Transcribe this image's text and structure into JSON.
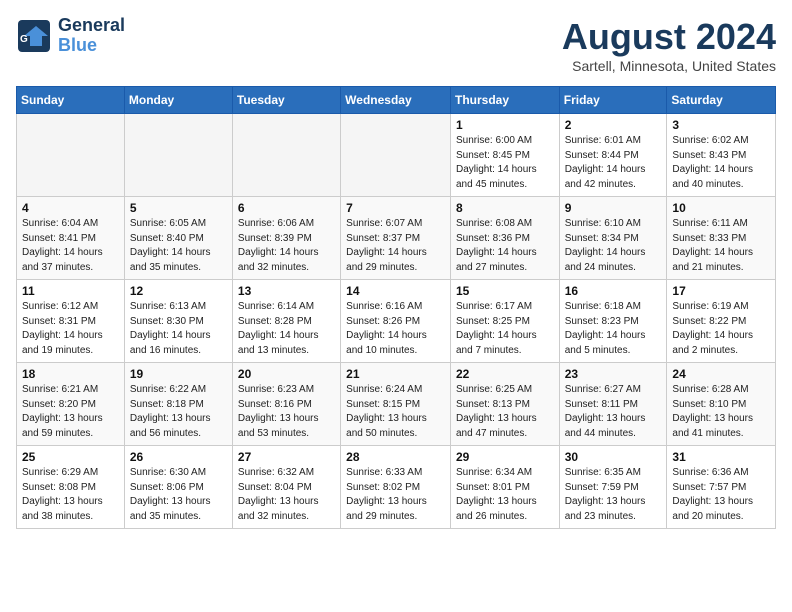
{
  "header": {
    "logo_line1": "General",
    "logo_line2": "Blue",
    "month": "August 2024",
    "location": "Sartell, Minnesota, United States"
  },
  "weekdays": [
    "Sunday",
    "Monday",
    "Tuesday",
    "Wednesday",
    "Thursday",
    "Friday",
    "Saturday"
  ],
  "weeks": [
    [
      {
        "day": "",
        "info": ""
      },
      {
        "day": "",
        "info": ""
      },
      {
        "day": "",
        "info": ""
      },
      {
        "day": "",
        "info": ""
      },
      {
        "day": "1",
        "info": "Sunrise: 6:00 AM\nSunset: 8:45 PM\nDaylight: 14 hours\nand 45 minutes."
      },
      {
        "day": "2",
        "info": "Sunrise: 6:01 AM\nSunset: 8:44 PM\nDaylight: 14 hours\nand 42 minutes."
      },
      {
        "day": "3",
        "info": "Sunrise: 6:02 AM\nSunset: 8:43 PM\nDaylight: 14 hours\nand 40 minutes."
      }
    ],
    [
      {
        "day": "4",
        "info": "Sunrise: 6:04 AM\nSunset: 8:41 PM\nDaylight: 14 hours\nand 37 minutes."
      },
      {
        "day": "5",
        "info": "Sunrise: 6:05 AM\nSunset: 8:40 PM\nDaylight: 14 hours\nand 35 minutes."
      },
      {
        "day": "6",
        "info": "Sunrise: 6:06 AM\nSunset: 8:39 PM\nDaylight: 14 hours\nand 32 minutes."
      },
      {
        "day": "7",
        "info": "Sunrise: 6:07 AM\nSunset: 8:37 PM\nDaylight: 14 hours\nand 29 minutes."
      },
      {
        "day": "8",
        "info": "Sunrise: 6:08 AM\nSunset: 8:36 PM\nDaylight: 14 hours\nand 27 minutes."
      },
      {
        "day": "9",
        "info": "Sunrise: 6:10 AM\nSunset: 8:34 PM\nDaylight: 14 hours\nand 24 minutes."
      },
      {
        "day": "10",
        "info": "Sunrise: 6:11 AM\nSunset: 8:33 PM\nDaylight: 14 hours\nand 21 minutes."
      }
    ],
    [
      {
        "day": "11",
        "info": "Sunrise: 6:12 AM\nSunset: 8:31 PM\nDaylight: 14 hours\nand 19 minutes."
      },
      {
        "day": "12",
        "info": "Sunrise: 6:13 AM\nSunset: 8:30 PM\nDaylight: 14 hours\nand 16 minutes."
      },
      {
        "day": "13",
        "info": "Sunrise: 6:14 AM\nSunset: 8:28 PM\nDaylight: 14 hours\nand 13 minutes."
      },
      {
        "day": "14",
        "info": "Sunrise: 6:16 AM\nSunset: 8:26 PM\nDaylight: 14 hours\nand 10 minutes."
      },
      {
        "day": "15",
        "info": "Sunrise: 6:17 AM\nSunset: 8:25 PM\nDaylight: 14 hours\nand 7 minutes."
      },
      {
        "day": "16",
        "info": "Sunrise: 6:18 AM\nSunset: 8:23 PM\nDaylight: 14 hours\nand 5 minutes."
      },
      {
        "day": "17",
        "info": "Sunrise: 6:19 AM\nSunset: 8:22 PM\nDaylight: 14 hours\nand 2 minutes."
      }
    ],
    [
      {
        "day": "18",
        "info": "Sunrise: 6:21 AM\nSunset: 8:20 PM\nDaylight: 13 hours\nand 59 minutes."
      },
      {
        "day": "19",
        "info": "Sunrise: 6:22 AM\nSunset: 8:18 PM\nDaylight: 13 hours\nand 56 minutes."
      },
      {
        "day": "20",
        "info": "Sunrise: 6:23 AM\nSunset: 8:16 PM\nDaylight: 13 hours\nand 53 minutes."
      },
      {
        "day": "21",
        "info": "Sunrise: 6:24 AM\nSunset: 8:15 PM\nDaylight: 13 hours\nand 50 minutes."
      },
      {
        "day": "22",
        "info": "Sunrise: 6:25 AM\nSunset: 8:13 PM\nDaylight: 13 hours\nand 47 minutes."
      },
      {
        "day": "23",
        "info": "Sunrise: 6:27 AM\nSunset: 8:11 PM\nDaylight: 13 hours\nand 44 minutes."
      },
      {
        "day": "24",
        "info": "Sunrise: 6:28 AM\nSunset: 8:10 PM\nDaylight: 13 hours\nand 41 minutes."
      }
    ],
    [
      {
        "day": "25",
        "info": "Sunrise: 6:29 AM\nSunset: 8:08 PM\nDaylight: 13 hours\nand 38 minutes."
      },
      {
        "day": "26",
        "info": "Sunrise: 6:30 AM\nSunset: 8:06 PM\nDaylight: 13 hours\nand 35 minutes."
      },
      {
        "day": "27",
        "info": "Sunrise: 6:32 AM\nSunset: 8:04 PM\nDaylight: 13 hours\nand 32 minutes."
      },
      {
        "day": "28",
        "info": "Sunrise: 6:33 AM\nSunset: 8:02 PM\nDaylight: 13 hours\nand 29 minutes."
      },
      {
        "day": "29",
        "info": "Sunrise: 6:34 AM\nSunset: 8:01 PM\nDaylight: 13 hours\nand 26 minutes."
      },
      {
        "day": "30",
        "info": "Sunrise: 6:35 AM\nSunset: 7:59 PM\nDaylight: 13 hours\nand 23 minutes."
      },
      {
        "day": "31",
        "info": "Sunrise: 6:36 AM\nSunset: 7:57 PM\nDaylight: 13 hours\nand 20 minutes."
      }
    ]
  ]
}
